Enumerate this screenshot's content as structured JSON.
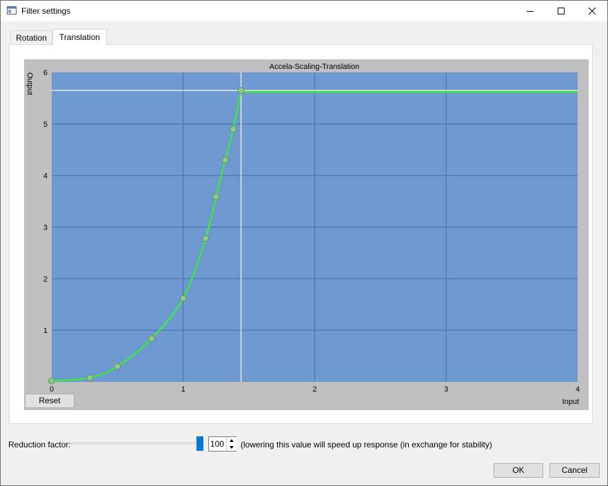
{
  "window": {
    "title": "Filter settings",
    "icon": "app-window-icon"
  },
  "title_buttons": {
    "minimize": "minimize-icon",
    "maximize": "maximize-icon",
    "close": "close-icon"
  },
  "tabs": [
    {
      "label": "Rotation",
      "active": false
    },
    {
      "label": "Translation",
      "active": true
    }
  ],
  "plot": {
    "reset_label": "Reset"
  },
  "reduction": {
    "label": "Reduction factor:",
    "slider_fraction": 1.0,
    "value": "100",
    "hint": "(lowering this value will speed up response (in exchange for stability)"
  },
  "buttons": {
    "ok": "OK",
    "cancel": "Cancel"
  },
  "colors": {
    "plot_area": "#6e99d1",
    "plot_frame": "#c0c0c0",
    "grid": "#4f7cb8",
    "curve": "#3ee83e",
    "point": "#8fc98f",
    "accent": "#0078d7"
  },
  "chart_data": {
    "type": "line",
    "title": "Accela-Scaling-Translation",
    "xlabel": "Input",
    "ylabel": "Output",
    "xlim": [
      0,
      4
    ],
    "ylim": [
      0,
      6
    ],
    "xticks": [
      "0",
      "1",
      "2",
      "3",
      "4"
    ],
    "yticks": [
      "1",
      "2",
      "3",
      "4",
      "5",
      "6"
    ],
    "grid": true,
    "points": [
      {
        "x": 0,
        "y": 0.02
      },
      {
        "x": 0.29,
        "y": 0.08
      },
      {
        "x": 0.5,
        "y": 0.3
      },
      {
        "x": 0.76,
        "y": 0.84
      },
      {
        "x": 1.0,
        "y": 1.62
      },
      {
        "x": 1.17,
        "y": 2.78
      },
      {
        "x": 1.25,
        "y": 3.59
      },
      {
        "x": 1.32,
        "y": 4.3
      },
      {
        "x": 1.38,
        "y": 4.9
      },
      {
        "x": 1.44,
        "y": 5.65
      }
    ],
    "plateau_y": 5.62,
    "crosshair": {
      "x": 1.44,
      "y": 5.65
    }
  }
}
